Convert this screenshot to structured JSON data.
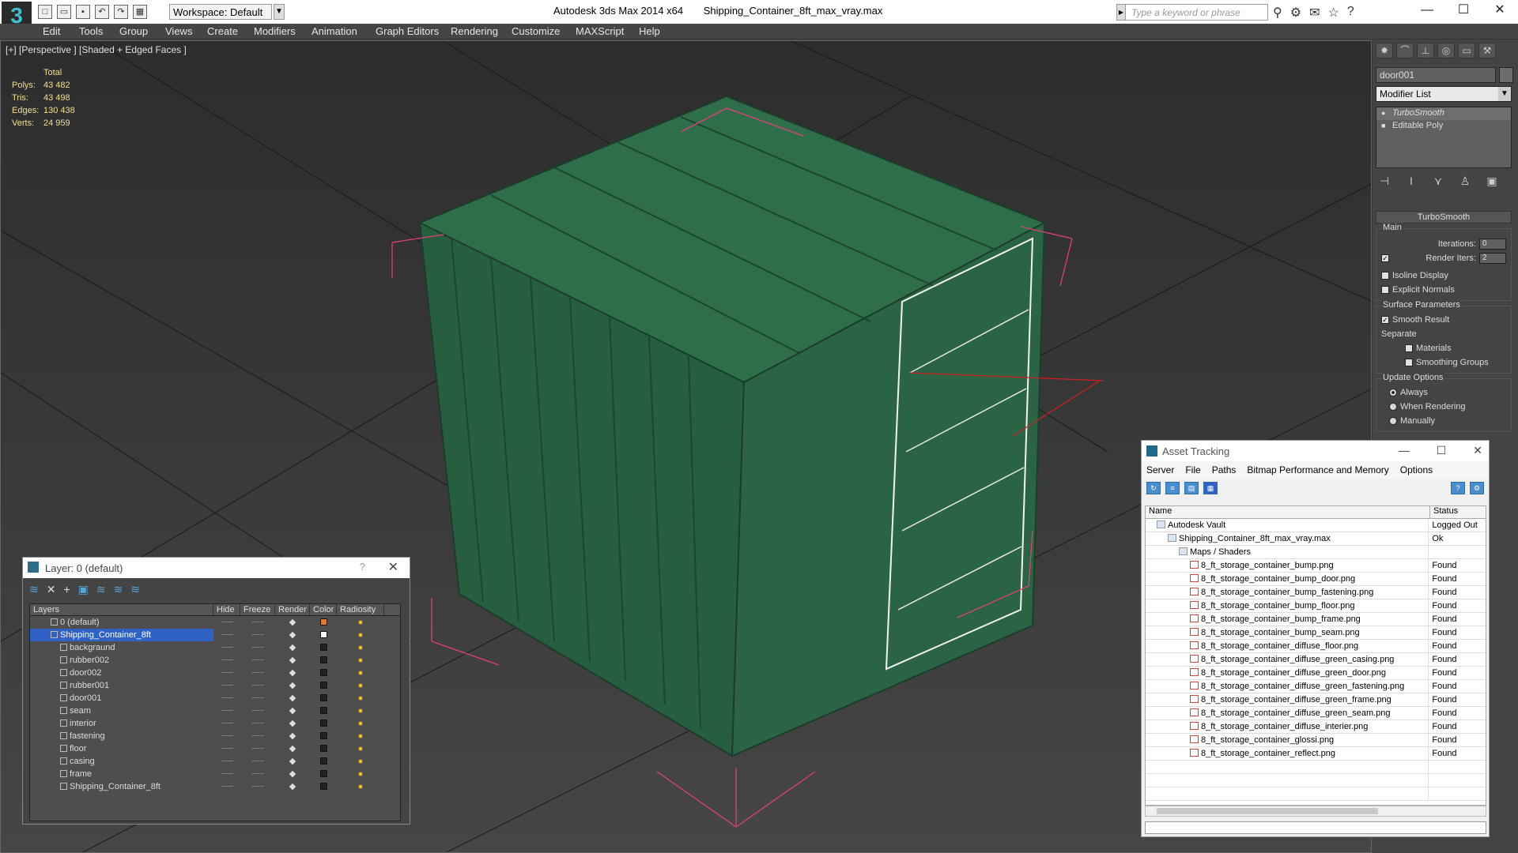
{
  "titlebar": {
    "app": "Autodesk 3ds Max  2014 x64",
    "file": "Shipping_Container_8ft_max_vray.max",
    "workspace": "Workspace: Default",
    "search_placeholder": "Type a keyword or phrase"
  },
  "menu": [
    "Edit",
    "Tools",
    "Group",
    "Views",
    "Create",
    "Modifiers",
    "Animation",
    "Graph Editors",
    "Rendering",
    "Customize",
    "MAXScript",
    "Help"
  ],
  "viewport": {
    "label": "[+] [Perspective ] [Shaded + Edged Faces ]",
    "stats_header": "Total",
    "stats": [
      {
        "k": "Polys:",
        "v": "43 482"
      },
      {
        "k": "Tris:",
        "v": "43 498"
      },
      {
        "k": "Edges:",
        "v": "130 438"
      },
      {
        "k": "Verts:",
        "v": "24 959"
      }
    ]
  },
  "command_panel": {
    "object_name": "door001",
    "modifier_list": "Modifier List",
    "stack": [
      "TurboSmooth",
      "Editable Poly"
    ],
    "rollout_title": "TurboSmooth",
    "main_label": "Main",
    "iterations_label": "Iterations:",
    "iterations_value": "0",
    "render_iters_label": "Render Iters:",
    "render_iters_value": "2",
    "isoline": "Isoline Display",
    "explicit": "Explicit Normals",
    "surface_label": "Surface Parameters",
    "smooth_result": "Smooth Result",
    "separate": "Separate",
    "materials": "Materials",
    "smoothing_groups": "Smoothing Groups",
    "update_label": "Update Options",
    "always": "Always",
    "when_rendering": "When Rendering",
    "manually": "Manually"
  },
  "layers_window": {
    "title": "Layer: 0 (default)",
    "columns": [
      "Layers",
      "Hide",
      "Freeze",
      "Render",
      "Color",
      "Radiosity"
    ],
    "rows": [
      {
        "name": "0 (default)",
        "color": "#e07a2e",
        "top": true
      },
      {
        "name": "Shipping_Container_8ft",
        "color": "#ffffff",
        "top": true,
        "selected": true
      },
      {
        "name": "backgraund",
        "color": "#222222"
      },
      {
        "name": "rubber002",
        "color": "#222222"
      },
      {
        "name": "door002",
        "color": "#222222"
      },
      {
        "name": "rubber001",
        "color": "#222222"
      },
      {
        "name": "door001",
        "color": "#222222"
      },
      {
        "name": "seam",
        "color": "#222222"
      },
      {
        "name": "interior",
        "color": "#222222"
      },
      {
        "name": "fastening",
        "color": "#222222"
      },
      {
        "name": "floor",
        "color": "#222222"
      },
      {
        "name": "casing",
        "color": "#222222"
      },
      {
        "name": "frame",
        "color": "#222222"
      },
      {
        "name": "Shipping_Container_8ft",
        "color": "#222222"
      }
    ]
  },
  "asset_tracking": {
    "title": "Asset Tracking",
    "menu": [
      "Server",
      "File",
      "Paths",
      "Bitmap Performance and Memory",
      "Options"
    ],
    "columns": [
      "Name",
      "Status"
    ],
    "rows": [
      {
        "name": "Autodesk Vault",
        "status": "Logged Out",
        "level": 0,
        "icon": "vault"
      },
      {
        "name": "Shipping_Container_8ft_max_vray.max",
        "status": "Ok",
        "level": 1,
        "icon": "max"
      },
      {
        "name": "Maps / Shaders",
        "status": "",
        "level": 2,
        "icon": "maps"
      },
      {
        "name": "8_ft_storage_container_bump.png",
        "status": "Found",
        "level": 3,
        "icon": "png"
      },
      {
        "name": "8_ft_storage_container_bump_door.png",
        "status": "Found",
        "level": 3,
        "icon": "png"
      },
      {
        "name": "8_ft_storage_container_bump_fastening.png",
        "status": "Found",
        "level": 3,
        "icon": "png"
      },
      {
        "name": "8_ft_storage_container_bump_floor.png",
        "status": "Found",
        "level": 3,
        "icon": "png"
      },
      {
        "name": "8_ft_storage_container_bump_frame.png",
        "status": "Found",
        "level": 3,
        "icon": "png"
      },
      {
        "name": "8_ft_storage_container_bump_seam.png",
        "status": "Found",
        "level": 3,
        "icon": "png"
      },
      {
        "name": "8_ft_storage_container_diffuse_floor.png",
        "status": "Found",
        "level": 3,
        "icon": "png"
      },
      {
        "name": "8_ft_storage_container_diffuse_green_casing.png",
        "status": "Found",
        "level": 3,
        "icon": "png"
      },
      {
        "name": "8_ft_storage_container_diffuse_green_door.png",
        "status": "Found",
        "level": 3,
        "icon": "png"
      },
      {
        "name": "8_ft_storage_container_diffuse_green_fastening.png",
        "status": "Found",
        "level": 3,
        "icon": "png"
      },
      {
        "name": "8_ft_storage_container_diffuse_green_frame.png",
        "status": "Found",
        "level": 3,
        "icon": "png"
      },
      {
        "name": "8_ft_storage_container_diffuse_green_seam.png",
        "status": "Found",
        "level": 3,
        "icon": "png"
      },
      {
        "name": "8_ft_storage_container_diffuse_interier.png",
        "status": "Found",
        "level": 3,
        "icon": "png"
      },
      {
        "name": "8_ft_storage_container_glossi.png",
        "status": "Found",
        "level": 3,
        "icon": "png"
      },
      {
        "name": "8_ft_storage_container_reflect.png",
        "status": "Found",
        "level": 3,
        "icon": "png"
      }
    ]
  },
  "colors": {
    "container": "#2c6a46",
    "bbox": "#e0407a",
    "grid": "#1c1c1c"
  }
}
